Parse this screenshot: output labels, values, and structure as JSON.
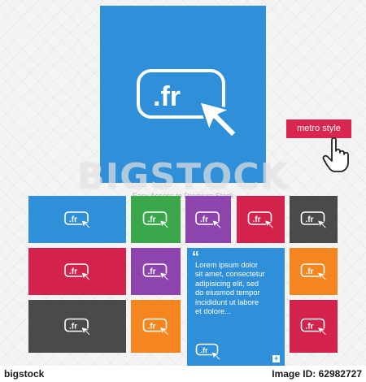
{
  "icon_text": ".fr",
  "watermark": "BIGSTOCK",
  "watermark_slogan": "Easy Access to Premium Stock",
  "metro_badge": "metro style",
  "text_panel": {
    "quote": "“",
    "body": "Lorem ipsum dolor\nsit amet, consectetur\nadipisicing elit, sed\ndo eiusmod tempor\nincididunt ut labore\net dolore...",
    "plus": "+"
  },
  "footer": {
    "logo": "bigstock",
    "image_id": "Image ID: 62982727"
  },
  "colors": {
    "blue": "#2f8fd8",
    "green": "#3aa84a",
    "purple": "#8e44ad",
    "crimson": "#d3224b",
    "dark": "#4a4a4a",
    "orange": "#f5861f",
    "badge": "#d9254f"
  },
  "tiles": [
    {
      "name": "tile-blue-wide",
      "color": "blue",
      "row": 1,
      "col": 1
    },
    {
      "name": "tile-green",
      "color": "green",
      "row": 1,
      "col": 2
    },
    {
      "name": "tile-purple",
      "color": "purple",
      "row": 1,
      "col": 3
    },
    {
      "name": "tile-crimson",
      "color": "crimson",
      "row": 1,
      "col": 4
    },
    {
      "name": "tile-dark",
      "color": "dark",
      "row": 1,
      "col": 5
    },
    {
      "name": "tile-crimson-wide",
      "color": "crimson",
      "row": 2,
      "col": 1
    },
    {
      "name": "tile-purple-2",
      "color": "purple",
      "row": 2,
      "col": 2
    },
    {
      "name": "tile-orange",
      "color": "orange",
      "row": 2,
      "col": 5
    },
    {
      "name": "tile-dark-wide",
      "color": "dark",
      "row": 3,
      "col": 1
    },
    {
      "name": "tile-orange-2",
      "color": "orange",
      "row": 3,
      "col": 2
    },
    {
      "name": "tile-crimson-2",
      "color": "crimson",
      "row": 3,
      "col": 5
    }
  ]
}
